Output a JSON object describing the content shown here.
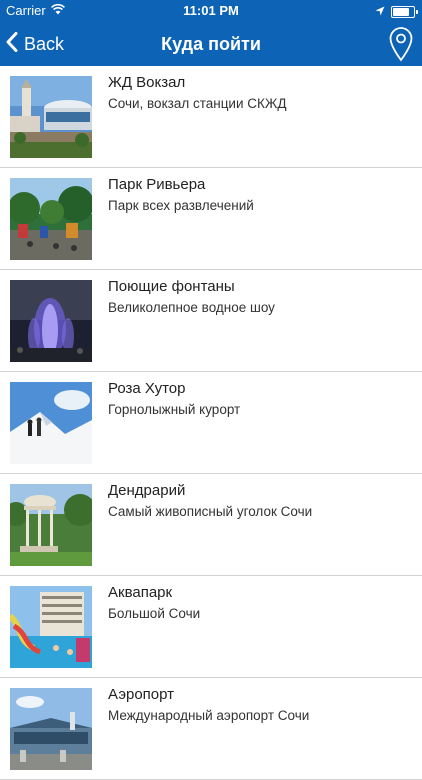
{
  "status_bar": {
    "carrier": "Carrier",
    "time": "11:01 PM",
    "battery_level": 0.9,
    "icons": [
      "wifi-icon",
      "location-arrow-icon",
      "battery-icon"
    ]
  },
  "nav": {
    "back_label": "Back",
    "title": "Куда пойти",
    "right_icon": "map-pin-icon"
  },
  "colors": {
    "accent": "#0d63b5",
    "separator": "#d3d3d3"
  },
  "places": [
    {
      "title": "ЖД Вокзал",
      "subtitle": "Сочи, вокзал станции СКЖД"
    },
    {
      "title": "Парк Ривьера",
      "subtitle": "Парк всех развлечений"
    },
    {
      "title": "Поющие фонтаны",
      "subtitle": "Великолепное водное шоу"
    },
    {
      "title": "Роза Хутор",
      "subtitle": "Горнолыжный курорт"
    },
    {
      "title": "Дендрарий",
      "subtitle": "Самый живописный уголок Сочи"
    },
    {
      "title": "Аквапарк",
      "subtitle": "Большой Сочи"
    },
    {
      "title": "Аэропорт",
      "subtitle": "Международный аэропорт Сочи"
    }
  ]
}
